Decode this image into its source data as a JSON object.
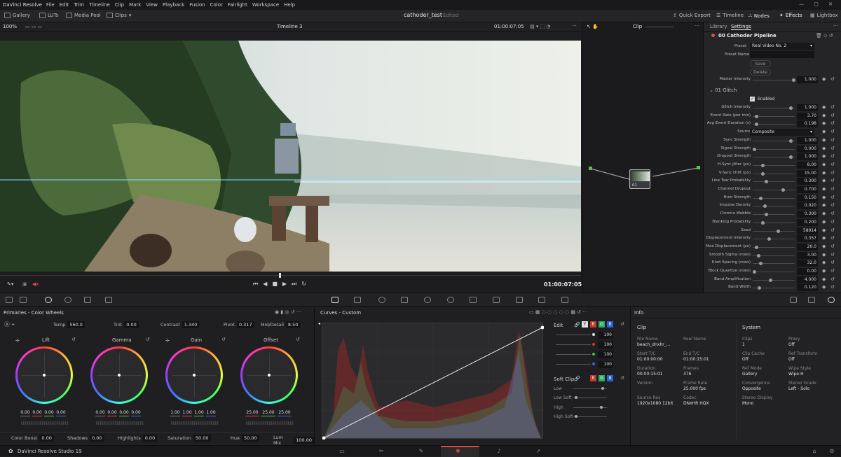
{
  "menubar": {
    "app": "DaVinci Resolve",
    "items": [
      "File",
      "Edit",
      "Trim",
      "Timeline",
      "Clip",
      "Mark",
      "View",
      "Playback",
      "Fusion",
      "Color",
      "Fairlight",
      "Workspace",
      "Help"
    ]
  },
  "toolbar": {
    "gallery": "Gallery",
    "luts": "LUTs",
    "media_pool": "Media Pool",
    "clips": "Clips",
    "project": "cathoder_test",
    "edited": "Edited",
    "quick_export": "Quick Export",
    "timeline": "Timeline",
    "nodes": "Nodes",
    "effects": "Effects",
    "lightbox": "Lightbox"
  },
  "viewer": {
    "zoom": "100%",
    "timeline_name": "Timeline 3",
    "timecode_top": "01:00:07:05",
    "timecode": "01:00:07:05",
    "clip_mode": "Clip"
  },
  "settings": {
    "tab_library": "Library",
    "tab_settings": "Settings",
    "pipeline": "00 Cathoder Pipeline",
    "preset_label": "Preset",
    "preset_value": "Real Video No. 2",
    "preset_name_label": "Preset Name",
    "save": "Save",
    "delete": "Delete",
    "master_label": "Master Intensity",
    "master_value": "1.000",
    "glitch_group": "01 Glitch",
    "enabled": "Enabled",
    "source_label": "Source",
    "source_value": "Composite",
    "params": [
      {
        "label": "Glitch Intensity",
        "value": "1.000",
        "pos": 0.9
      },
      {
        "label": "Event Rate (per min)",
        "value": "3.70",
        "pos": 0.05
      },
      {
        "label": "Avg Event Duration (s)",
        "value": "0.198",
        "pos": 0.05
      },
      {
        "label": "__source__",
        "value": "",
        "pos": 0
      },
      {
        "label": "Sync Strength",
        "value": "1.000",
        "pos": 0.9
      },
      {
        "label": "Signal Strength",
        "value": "0.000",
        "pos": 0.0
      },
      {
        "label": "Dropout Strength",
        "value": "1.000",
        "pos": 0.9
      },
      {
        "label": "H-Sync Jitter (px)",
        "value": "8.00",
        "pos": 0.2
      },
      {
        "label": "V-Sync Drift (px)",
        "value": "15.00",
        "pos": 0.2
      },
      {
        "label": "Line Tear Probability",
        "value": "0.300",
        "pos": 0.3
      },
      {
        "label": "Channel Dropout",
        "value": "0.700",
        "pos": 0.7
      },
      {
        "label": "Hum Strength",
        "value": "0.150",
        "pos": 0.15
      },
      {
        "label": "Impulse Density",
        "value": "0.020",
        "pos": 0.25
      },
      {
        "label": "Chroma Wobble",
        "value": "0.300",
        "pos": 0.3
      },
      {
        "label": "Blanking Probability",
        "value": "0.200",
        "pos": 0.2
      },
      {
        "label": "Seed",
        "value": "58914",
        "pos": 0.58
      },
      {
        "label": "Displacement Intensity",
        "value": "0.357",
        "pos": 0.36
      },
      {
        "label": "Max Displacement (px)",
        "value": "20.0",
        "pos": 0.05
      },
      {
        "label": "Smooth Sigma (rows)",
        "value": "3.00",
        "pos": 0.1
      },
      {
        "label": "Knot Spacing (rows)",
        "value": "32.0",
        "pos": 0.15
      },
      {
        "label": "Block Quantize (rows)",
        "value": "0.00",
        "pos": 0.0
      },
      {
        "label": "Band Amplification",
        "value": "4.000",
        "pos": 0.4
      },
      {
        "label": "Band Width",
        "value": "0.120",
        "pos": 0.12
      }
    ]
  },
  "primaries": {
    "title": "Primaries - Color Wheels",
    "temp_label": "Temp",
    "temp": "560.0",
    "tint_label": "Tint",
    "tint": "0.00",
    "contrast_label": "Contrast",
    "contrast": "1.340",
    "pivot_label": "Pivot",
    "pivot": "0.317",
    "middetail_label": "Mid/Detail",
    "middetail": "8.50",
    "wheels": [
      {
        "name": "Lift",
        "values": [
          "0.00",
          "0.00",
          "0.00",
          "0.00"
        ]
      },
      {
        "name": "Gamma",
        "values": [
          "0.00",
          "0.00",
          "0.00",
          "0.00"
        ]
      },
      {
        "name": "Gain",
        "values": [
          "1.00",
          "1.00",
          "1.00",
          "1.00"
        ]
      },
      {
        "name": "Offset",
        "values": [
          "25.00",
          "25.00",
          "25.00"
        ]
      }
    ],
    "color_boost_label": "Color Boost",
    "color_boost": "0.00",
    "shadows_label": "Shadows",
    "shadows": "0.00",
    "highlights_label": "Highlights",
    "highlights": "0.00",
    "saturation_label": "Saturation",
    "saturation": "50.00",
    "hue_label": "Hue",
    "hue": "50.00",
    "lummix_label": "Lum Mix",
    "lummix": "100.00"
  },
  "curves": {
    "title": "Curves - Custom",
    "edit_label": "Edit",
    "edit_values": [
      "100",
      "100",
      "100",
      "100"
    ],
    "softclip_label": "Soft Clip",
    "low_label": "Low",
    "lowsoft_label": "Low Soft",
    "high_label": "High",
    "highsoft_label": "High Soft"
  },
  "info": {
    "title": "Info",
    "clip_header": "Clip",
    "system_header": "System",
    "clip_fields": [
      {
        "label": "File Name",
        "value": "beach_dnxhr_..."
      },
      {
        "label": "Reel Name",
        "value": ""
      },
      {
        "label": "Start T/C",
        "value": "01:00:00:00"
      },
      {
        "label": "End T/C",
        "value": "01:00:15:01"
      },
      {
        "label": "Duration",
        "value": "00:00:15:01"
      },
      {
        "label": "Frames",
        "value": "376"
      },
      {
        "label": "Version",
        "value": ""
      },
      {
        "label": "Frame Rate",
        "value": "25.000 fps"
      },
      {
        "label": "Source Res",
        "value": "1920x1080 12bit"
      },
      {
        "label": "Codec",
        "value": "DNxHR HQX"
      }
    ],
    "system_fields": [
      {
        "label": "Clips",
        "value": "1"
      },
      {
        "label": "Proxy",
        "value": "Off"
      },
      {
        "label": "Clip Cache",
        "value": "Off"
      },
      {
        "label": "Ref Transform",
        "value": "Off"
      },
      {
        "label": "Ref Mode",
        "value": "Gallery"
      },
      {
        "label": "Wipe Style",
        "value": "Wipe-H"
      },
      {
        "label": "Convergence",
        "value": "Opposite"
      },
      {
        "label": "Stereo Grade",
        "value": "Left - Solo"
      },
      {
        "label": "Stereo Display",
        "value": "Mono"
      }
    ]
  },
  "statusbar": {
    "app_name": "DaVinci Resolve Studio 19"
  },
  "node": {
    "label": "01"
  },
  "colors": {
    "accent": "#e64b3c",
    "bg": "#1f1f22"
  }
}
